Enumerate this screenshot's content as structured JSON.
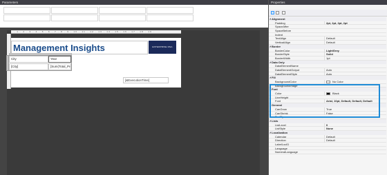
{
  "parameters": {
    "title": "Parameters",
    "cells": 8
  },
  "properties": {
    "title": "Properties"
  },
  "report": {
    "title": "Management Insights",
    "logo_text": "ENTERPRISE DNA",
    "ruler_text": "· 1 · 2 · 3 · 4 · 5 · 6 · 7 · 8 · 9 · 10 · 11 · 12 · 13 · 14 · 15 · 16 · 17 · 18 · 19 ·",
    "header_row": [
      "City",
      "Year"
    ],
    "data_row": [
      "[City]",
      "[Sum(Total_Pro"
    ],
    "execution_time": "[&ExecutionTime]"
  },
  "property_rows": [
    {
      "type": "cat",
      "name": "Alignment"
    },
    {
      "type": "prop",
      "name": "Padding",
      "value": "2pt, 2pt, 2pt, 2pt",
      "bold": true
    },
    {
      "type": "prop",
      "name": "SpaceAfter",
      "value": ""
    },
    {
      "type": "prop",
      "name": "SpaceBefore",
      "value": ""
    },
    {
      "type": "prop",
      "name": "Indent",
      "value": ""
    },
    {
      "type": "prop",
      "name": "TextAlign",
      "value": "Default"
    },
    {
      "type": "prop",
      "name": "VerticalAlign",
      "value": "Default"
    },
    {
      "type": "cat",
      "name": "Border"
    },
    {
      "type": "prop",
      "name": "BorderColor",
      "value": "LightGrey",
      "bold": true
    },
    {
      "type": "prop",
      "name": "BorderStyle",
      "value": "Solid",
      "bold": true
    },
    {
      "type": "prop",
      "name": "BorderWidth",
      "value": "1pt"
    },
    {
      "type": "cat",
      "name": "Data Only"
    },
    {
      "type": "prop",
      "name": "DataElementName",
      "value": ""
    },
    {
      "type": "prop",
      "name": "DataElementOutput",
      "value": "Auto"
    },
    {
      "type": "prop",
      "name": "DataElementStyle",
      "value": "Auto"
    },
    {
      "type": "cat",
      "name": "Fill"
    },
    {
      "type": "prop",
      "name": "BackgroundColor",
      "value": "No Color",
      "swatch": "#ffffff"
    },
    {
      "type": "prop",
      "name": "BackgroundImage",
      "value": ""
    },
    {
      "type": "cat",
      "name": "Font"
    },
    {
      "type": "prop",
      "name": "Color",
      "value": "Black",
      "swatch": "#000000"
    },
    {
      "type": "prop",
      "name": "LineHeight",
      "value": ""
    },
    {
      "type": "prop",
      "name": "Font",
      "value": "Arial, 10pt, Default, Default, Default",
      "bold": true
    },
    {
      "type": "cat",
      "name": "General"
    },
    {
      "type": "prop",
      "name": "CanGrow",
      "value": "True"
    },
    {
      "type": "prop",
      "name": "CanShrink",
      "value": "False"
    },
    {
      "type": "prop",
      "name": "ToolTip",
      "value": ""
    },
    {
      "type": "cat",
      "name": "Lists"
    },
    {
      "type": "prop",
      "name": "ListLevel",
      "value": "0",
      "bold": true
    },
    {
      "type": "prop",
      "name": "ListStyle",
      "value": "None",
      "bold": true
    },
    {
      "type": "cat",
      "name": "Localization"
    },
    {
      "type": "prop",
      "name": "Calendar",
      "value": "Default"
    },
    {
      "type": "prop",
      "name": "Direction",
      "value": "Default"
    },
    {
      "type": "prop",
      "name": "LabelLocID",
      "value": ""
    },
    {
      "type": "prop",
      "name": "Language",
      "value": ""
    },
    {
      "type": "prop",
      "name": "NumeralLanguage",
      "value": ""
    }
  ],
  "colors": {
    "accent": "#1e8bd6",
    "title_blue": "#1a4c8b",
    "logo_bg": "#1b2a5a"
  }
}
